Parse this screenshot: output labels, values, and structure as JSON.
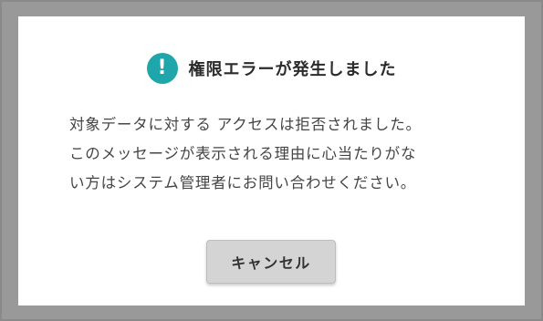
{
  "dialog": {
    "icon": "exclamation-icon",
    "icon_glyph": "!",
    "title": "権限エラーが発生しました",
    "message_lines": [
      "対象データに対する アクセスは拒否されました。",
      "このメッセージが表示される理由に心当たりがな",
      "い方はシステム管理者にお問い合わせください。"
    ],
    "cancel_label": "キャンセル"
  },
  "colors": {
    "accent": "#1fa6aa",
    "overlay": "#999999",
    "button": "#d4d4d4"
  }
}
